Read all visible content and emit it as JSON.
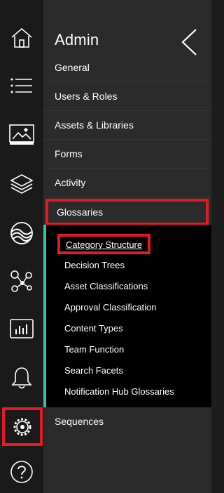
{
  "rail": {
    "items": [
      {
        "icon": "home-icon"
      },
      {
        "icon": "menu-lines-icon"
      },
      {
        "icon": "image-icon"
      },
      {
        "icon": "layers-icon"
      },
      {
        "icon": "globe-wave-icon"
      },
      {
        "icon": "network-icon"
      },
      {
        "icon": "bar-chart-icon"
      },
      {
        "icon": "bell-icon"
      },
      {
        "icon": "settings-gear-icon",
        "active": true
      },
      {
        "icon": "help-question-icon"
      }
    ]
  },
  "panel": {
    "title": "Admin",
    "back_icon": "chevron-left-icon",
    "menu": [
      {
        "label": "General"
      },
      {
        "label": "Users & Roles"
      },
      {
        "label": "Assets & Libraries"
      },
      {
        "label": "Forms"
      },
      {
        "label": "Activity"
      },
      {
        "label": "Glossaries",
        "active": true
      }
    ],
    "submenu": [
      {
        "label": "Category Structure",
        "active": true
      },
      {
        "label": "Decision Trees"
      },
      {
        "label": "Asset Classifications"
      },
      {
        "label": "Approval Classification"
      },
      {
        "label": "Content Types"
      },
      {
        "label": "Team Function"
      },
      {
        "label": "Search Facets"
      },
      {
        "label": "Notification Hub Glossaries"
      }
    ],
    "after": {
      "label": "Sequences"
    }
  },
  "colors": {
    "rail_bg": "#1a1a1a",
    "panel_bg": "#2b2b2b",
    "submenu_bg": "#000000",
    "accent": "#35c3a8",
    "highlight": "#e21b23"
  }
}
